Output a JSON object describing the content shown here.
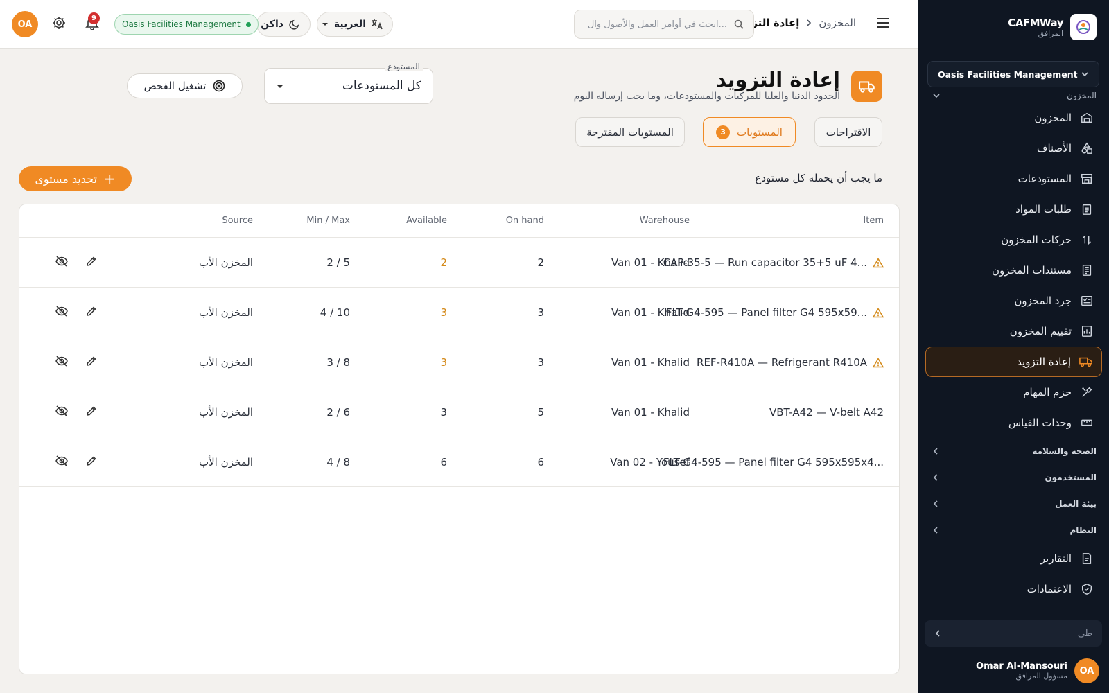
{
  "sidebar": {
    "brand_name": "CAFMWay",
    "brand_sub": "المرافق",
    "org_select": "Oasis Facilities Management",
    "section_inventory": "المخزون",
    "items": [
      {
        "label": "المخزون",
        "icon": "warehouse-icon"
      },
      {
        "label": "الأصناف",
        "icon": "shapes-icon"
      },
      {
        "label": "المستودعات",
        "icon": "store-icon"
      },
      {
        "label": "طلبات المواد",
        "icon": "clipboard-icon"
      },
      {
        "label": "حركات المخزون",
        "icon": "arrows-updown-icon"
      },
      {
        "label": "مستندات المخزون",
        "icon": "document-icon"
      },
      {
        "label": "جرد المخزون",
        "icon": "checklist-icon"
      },
      {
        "label": "تقييم المخزون",
        "icon": "valuation-icon"
      },
      {
        "label": "إعادة التزويد",
        "icon": "truck-icon",
        "active": true
      },
      {
        "label": "حزم المهام",
        "icon": "tools-icon"
      },
      {
        "label": "وحدات القياس",
        "icon": "ruler-icon"
      }
    ],
    "sections": [
      "الصحة والسلامة",
      "المستخدمون",
      "بيئة العمل",
      "النظام"
    ],
    "bottom_items": [
      {
        "label": "التقارير",
        "icon": "report-icon"
      },
      {
        "label": "الاعتمادات",
        "icon": "shield-check-icon"
      }
    ],
    "collapse_label": "طي",
    "user": {
      "initials": "OA",
      "name": "Omar Al-Mansouri",
      "role": "مسؤول المرافق"
    }
  },
  "topbar": {
    "breadcrumb": {
      "parent": "المخزون",
      "current": "إعادة التزويد"
    },
    "search_placeholder": "ابحث في أوامر العمل والأصول وال...",
    "language": "العربية",
    "theme": "داكن",
    "org_badge": "Oasis Facilities Management",
    "notifications_count": "9",
    "avatar_initials": "OA"
  },
  "page": {
    "title": "إعادة التزويد",
    "subtitle": "الحدود الدنيا والعليا للمركبات والمستودعات، وما يجب إرساله اليوم",
    "warehouse_label": "المستودع",
    "warehouse_value": "كل المستودعات",
    "scan_button": "تشغيل الفحص",
    "tabs": [
      {
        "label": "الاقتراحات"
      },
      {
        "label": "المستويات",
        "count": "3",
        "active": true
      },
      {
        "label": "المستويات المقترحة"
      }
    ],
    "section_title": "ما يجب أن يحمله كل مستودع",
    "add_button": "تحديد مستوى"
  },
  "table": {
    "headers": {
      "item": "Item",
      "warehouse": "Warehouse",
      "on_hand": "On hand",
      "available": "Available",
      "min_max": "Min / Max",
      "source": "Source"
    },
    "rows": [
      {
        "item": "CAP-35-5 — Run capacitor 35+5 uF 4...",
        "warning": true,
        "warehouse": "Van 01 - Khalid",
        "on_hand": "2",
        "available": "2",
        "available_warn": true,
        "min_max": "2 / 5",
        "source": "المخزن الأب"
      },
      {
        "item": "FLT-G4-595 — Panel filter G4 595x59...",
        "warning": true,
        "warehouse": "Van 01 - Khalid",
        "on_hand": "3",
        "available": "3",
        "available_warn": true,
        "min_max": "4 / 10",
        "source": "المخزن الأب"
      },
      {
        "item": "REF-R410A — Refrigerant R410A",
        "warning": true,
        "warehouse": "Van 01 - Khalid",
        "on_hand": "3",
        "available": "3",
        "available_warn": true,
        "min_max": "3 / 8",
        "source": "المخزن الأب"
      },
      {
        "item": "VBT-A42 — V-belt A42",
        "warning": false,
        "warehouse": "Van 01 - Khalid",
        "on_hand": "5",
        "available": "3",
        "available_warn": false,
        "min_max": "2 / 6",
        "source": "المخزن الأب"
      },
      {
        "item": "FLT-G4-595 — Panel filter G4 595x595x4...",
        "warning": false,
        "warehouse": "Van 02 - Yousef",
        "on_hand": "6",
        "available": "6",
        "available_warn": false,
        "min_max": "4 / 8",
        "source": "المخزن الأب"
      }
    ]
  },
  "colors": {
    "accent": "#f08a24",
    "sidebar_bg": "#0f1622",
    "warning": "#d48a1a",
    "success": "#22a058"
  }
}
